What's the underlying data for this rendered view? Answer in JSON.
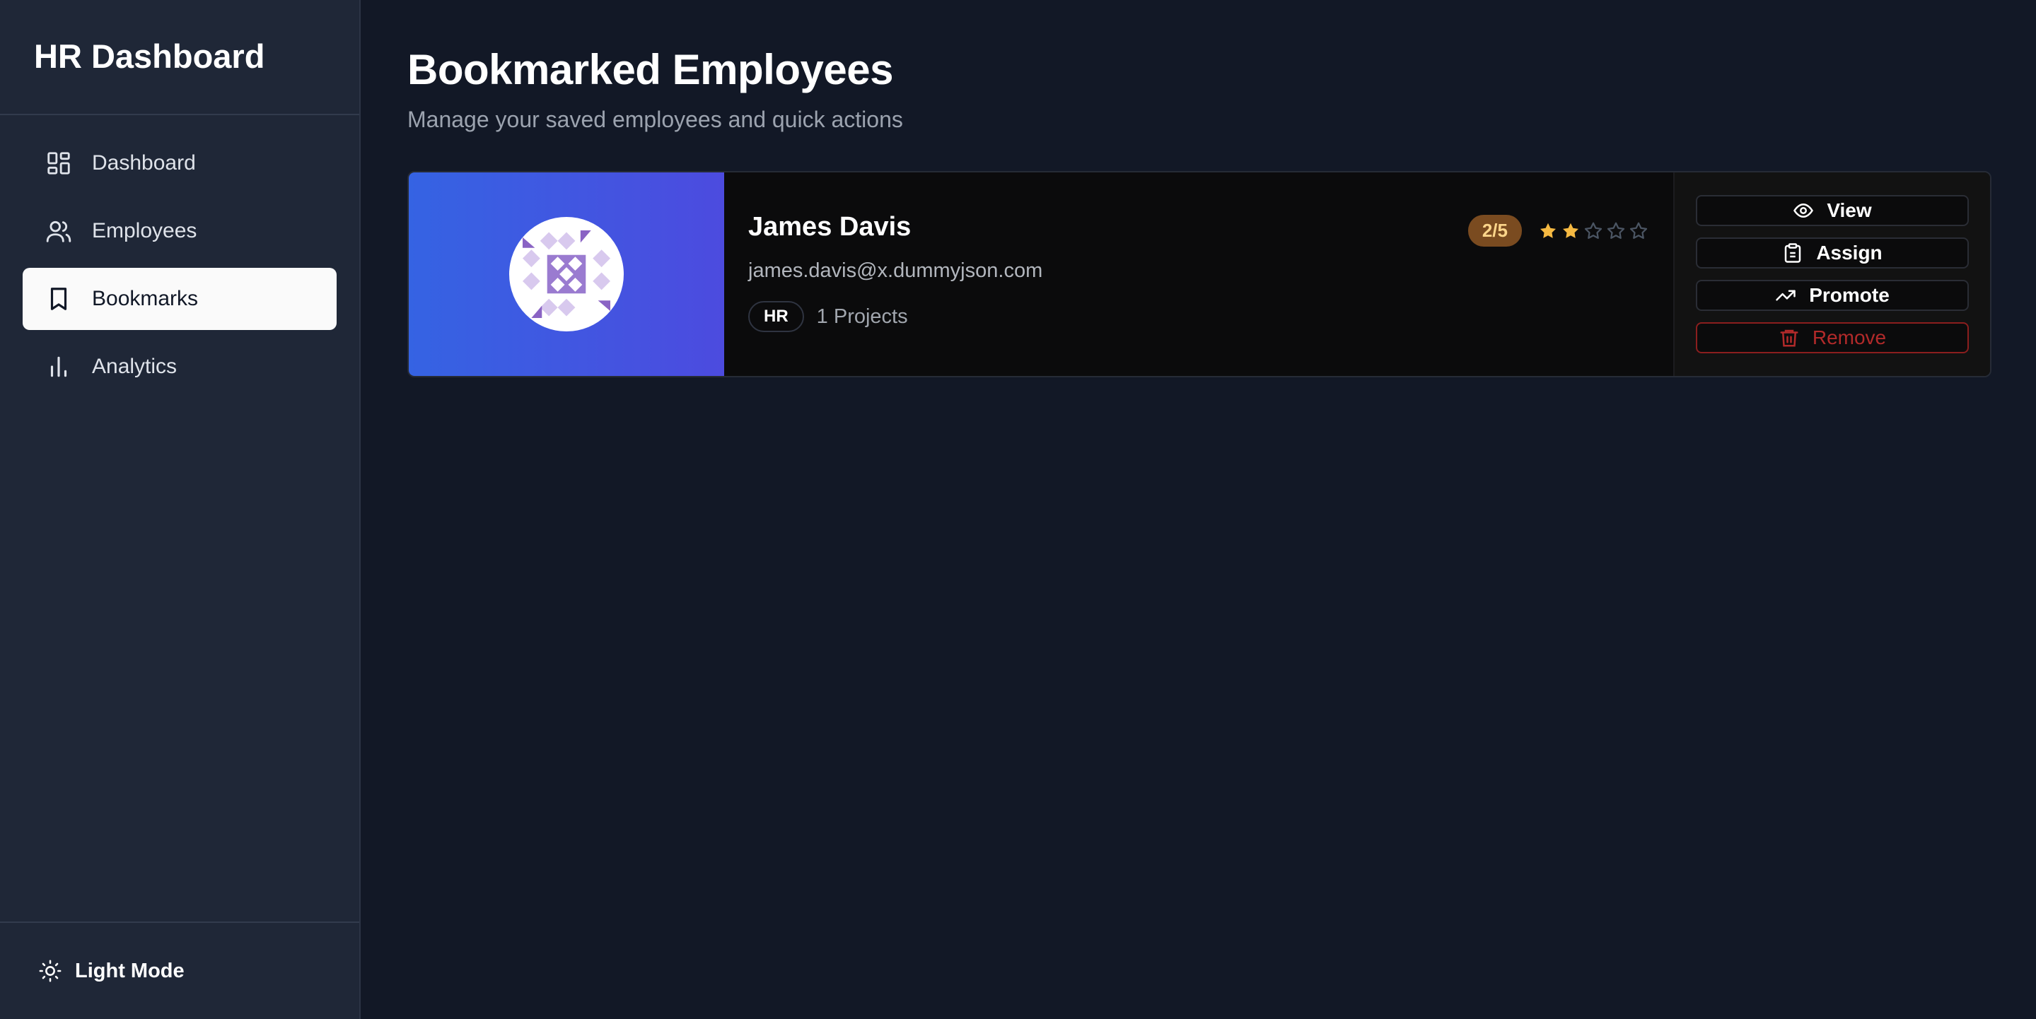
{
  "sidebar": {
    "brand": "HR Dashboard",
    "items": [
      {
        "label": "Dashboard",
        "icon": "dashboard-grid-icon"
      },
      {
        "label": "Employees",
        "icon": "users-icon"
      },
      {
        "label": "Bookmarks",
        "icon": "bookmark-icon",
        "active": true
      },
      {
        "label": "Analytics",
        "icon": "bar-chart-icon"
      }
    ],
    "theme_toggle": {
      "label": "Light Mode",
      "icon": "sun-icon"
    }
  },
  "page": {
    "title": "Bookmarked Employees",
    "subtitle": "Manage your saved employees and quick actions"
  },
  "bookmarks": [
    {
      "name": "James Davis",
      "email": "james.davis@x.dummyjson.com",
      "department": "HR",
      "projects": "1 Projects",
      "rating_label": "2/5",
      "rating": 2,
      "rating_max": 5,
      "actions": {
        "view": "View",
        "assign": "Assign",
        "promote": "Promote",
        "remove": "Remove"
      }
    }
  ],
  "colors": {
    "background": "#121826",
    "sidebar": "#1f2737",
    "star_filled": "#f5b942",
    "star_empty": "#4b5563",
    "danger": "#b22a2a",
    "media_gradient_start": "#3563e3",
    "media_gradient_end": "#4c4bdf"
  }
}
